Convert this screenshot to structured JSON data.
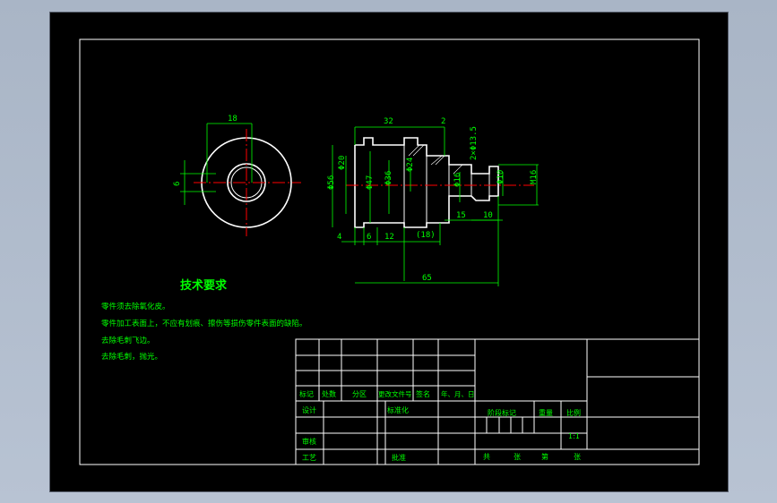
{
  "colors": {
    "background": "#000000",
    "frame": "#ffffff",
    "dimension": "#00ff00",
    "centerline": "#ff0000",
    "outline": "#ffffff"
  },
  "dimensions": {
    "front_width": "18",
    "front_height": "6",
    "total_length_top": "32",
    "groove_width": "2",
    "thread": "2×Φ13.5",
    "d56": "Φ56",
    "d20": "Φ20",
    "d47": "Φ47",
    "d36": "Φ36",
    "d24": "Φ24",
    "d16": "Φ16",
    "d10": "Φ10",
    "m16": "M16",
    "len15": "15",
    "len10": "10",
    "len4": "4",
    "len6": "6",
    "len12": "12",
    "len18_ref": "(18)",
    "total_length": "65"
  },
  "requirements": {
    "title": "技术要求",
    "items": [
      "零件须去除氧化皮。",
      "零件加工表面上，不应有划痕、擦伤等损伤零件表面的缺陷。",
      "去除毛刺飞边。",
      "去除毛刺，抛光。"
    ]
  },
  "title_block": {
    "mark": "标记",
    "count": "处数",
    "zone": "分区",
    "doc_no": "更改文件号",
    "sign": "签名",
    "date": "年、月、日",
    "design": "设计",
    "standardize": "标准化",
    "stage_mark": "阶段标记",
    "weight": "重量",
    "scale": "比例",
    "scale_value": "1:1",
    "review": "审核",
    "process": "工艺",
    "approve": "批准",
    "total": "共",
    "sheet": "张",
    "page": "第",
    "page_unit": "张"
  }
}
